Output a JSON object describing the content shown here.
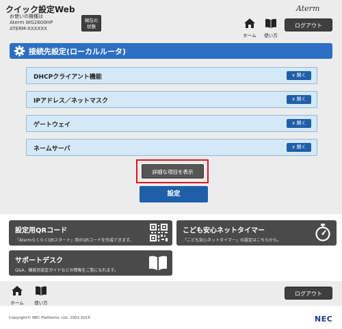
{
  "header": {
    "app_title": "クイック設定Web",
    "model_caption": "お使いの機種は",
    "model_name": "Aterm WG2600HP",
    "model_serial": "ATERM-XXXXXX",
    "status_button_line1": "現在の",
    "status_button_line2": "状態",
    "brand": "Aterm",
    "home_label": "ホーム",
    "guide_label": "使い方",
    "logout_label": "ログアウト"
  },
  "section": {
    "title": "接続先設定(ローカルルータ)",
    "items": [
      {
        "label": "DHCPクライアント機能",
        "button": "開く"
      },
      {
        "label": "IPアドレス／ネットマスク",
        "button": "開く"
      },
      {
        "label": "ゲートウェイ",
        "button": "開く"
      },
      {
        "label": "ネームサーバ",
        "button": "開く"
      }
    ],
    "detail_button": "詳細な項目を表示",
    "submit_button": "設定"
  },
  "tiles": [
    {
      "title": "設定用QRコード",
      "desc": "「AtermらくらくQRスタート」用のQRコードを作成できます。",
      "icon": "qr-code-icon"
    },
    {
      "title": "こども安心ネットタイマー",
      "desc": "「こども安心ネットタイマー」の設定はこちらから。",
      "icon": "stopwatch-icon"
    },
    {
      "title": "サポートデスク",
      "desc": "Q&A、機能別設定ガイドなどの情報をご覧になれます。",
      "icon": "book-icon"
    }
  ],
  "footer": {
    "home_label": "ホーム",
    "guide_label": "使い方",
    "logout_label": "ログアウト",
    "copyright": "Copyright© NEC Platforms, Ltd. 2001-2015",
    "logo": "NEC"
  },
  "colors": {
    "accent_blue": "#2c6fc4",
    "button_blue": "#1f5faa",
    "row_fill": "#d5e8f7",
    "dark_button": "#3f3f3f",
    "highlight_red": "#e0141c"
  }
}
